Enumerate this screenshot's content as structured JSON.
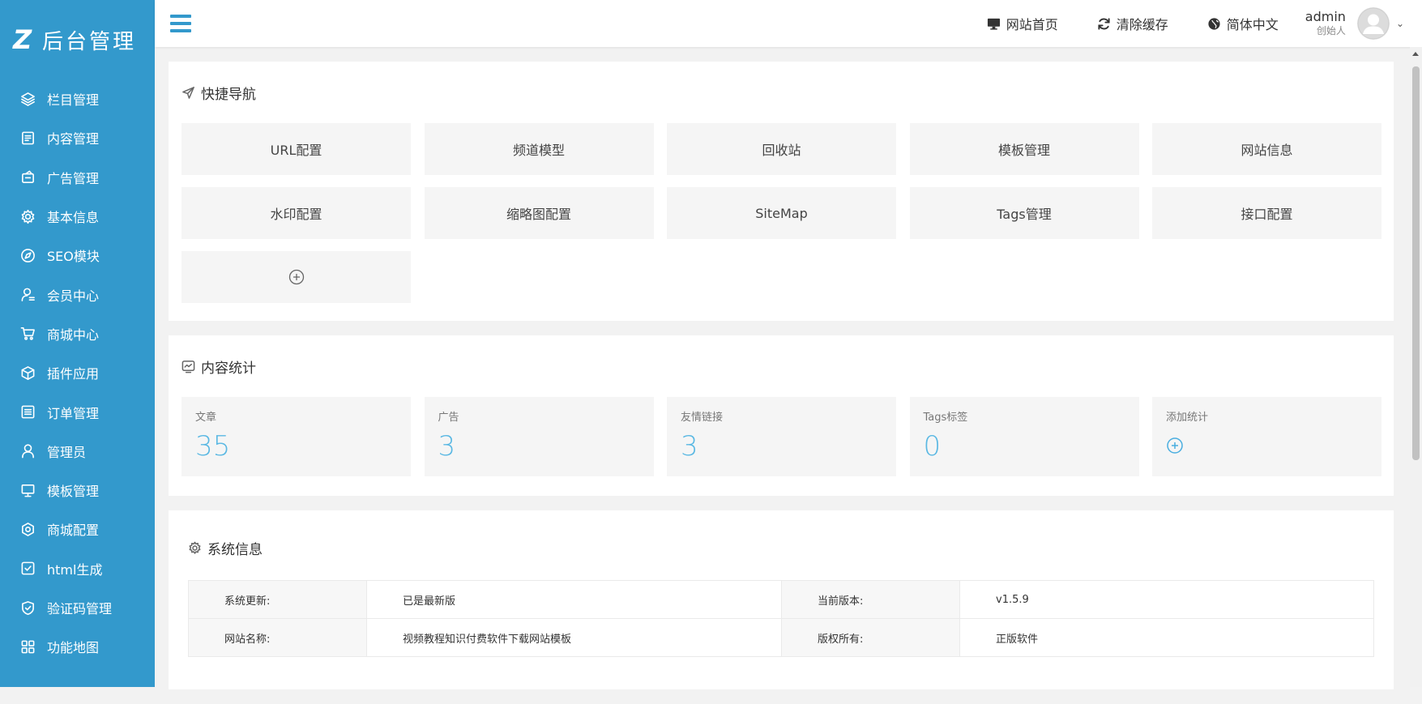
{
  "sidebar": {
    "logo_mark": "Z",
    "logo_text": "后台管理",
    "items": [
      {
        "label": "栏目管理",
        "icon": "layers-icon"
      },
      {
        "label": "内容管理",
        "icon": "document-icon"
      },
      {
        "label": "广告管理",
        "icon": "ad-icon"
      },
      {
        "label": "基本信息",
        "icon": "gear-icon"
      },
      {
        "label": "SEO模块",
        "icon": "compass-icon"
      },
      {
        "label": "会员中心",
        "icon": "member-icon"
      },
      {
        "label": "商城中心",
        "icon": "cart-icon"
      },
      {
        "label": "插件应用",
        "icon": "box-icon"
      },
      {
        "label": "订单管理",
        "icon": "list-icon"
      },
      {
        "label": "管理员",
        "icon": "user-icon"
      },
      {
        "label": "模板管理",
        "icon": "monitor-icon"
      },
      {
        "label": "商城配置",
        "icon": "hex-icon"
      },
      {
        "label": "html生成",
        "icon": "check-square-icon"
      },
      {
        "label": "验证码管理",
        "icon": "shield-icon"
      },
      {
        "label": "功能地图",
        "icon": "grid-icon"
      }
    ]
  },
  "header": {
    "site_home": "网站首页",
    "clear_cache": "清除缓存",
    "language": "简体中文",
    "user_name": "admin",
    "user_role": "创始人"
  },
  "quick_nav": {
    "title": "快捷导航",
    "buttons": [
      "URL配置",
      "频道模型",
      "回收站",
      "模板管理",
      "网站信息",
      "水印配置",
      "缩略图配置",
      "SiteMap",
      "Tags管理",
      "接口配置"
    ]
  },
  "stats": {
    "title": "内容统计",
    "items": [
      {
        "label": "文章",
        "value": "35"
      },
      {
        "label": "广告",
        "value": "3"
      },
      {
        "label": "友情链接",
        "value": "3"
      },
      {
        "label": "Tags标签",
        "value": "0"
      }
    ],
    "add_label": "添加统计"
  },
  "system": {
    "title": "系统信息",
    "rows": [
      {
        "k1": "系统更新:",
        "v1": "已是最新版",
        "k2": "当前版本:",
        "v2": "v1.5.9"
      },
      {
        "k1": "网站名称:",
        "v1": "视频教程知识付费软件下载网站模板",
        "k2": "版权所有:",
        "v2": "正版软件"
      }
    ]
  },
  "colors": {
    "sidebar": "#3399cc",
    "accent": "#5ab8e3"
  }
}
